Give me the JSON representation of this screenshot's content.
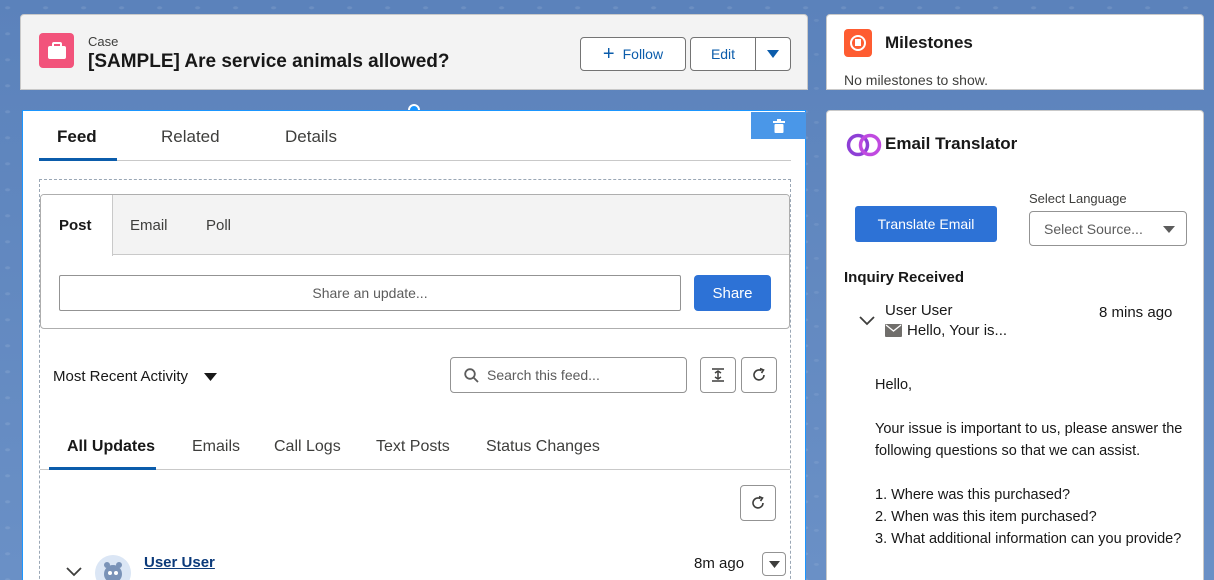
{
  "record": {
    "object_label": "Case",
    "title": "[SAMPLE] Are service animals allowed?",
    "follow_label": "Follow",
    "edit_label": "Edit"
  },
  "feed_tabs": [
    "Feed",
    "Related",
    "Details"
  ],
  "publisher": {
    "tabs": [
      "Post",
      "Email",
      "Poll"
    ],
    "input_placeholder": "Share an update...",
    "share_label": "Share"
  },
  "feed": {
    "sort_label": "Most Recent Activity",
    "search_placeholder": "Search this feed...",
    "filter_tabs": [
      "All Updates",
      "Emails",
      "Call Logs",
      "Text Posts",
      "Status Changes"
    ],
    "items": [
      {
        "user": "User User",
        "time": "8m ago"
      }
    ]
  },
  "milestones": {
    "title": "Milestones",
    "empty_text": "No milestones to show."
  },
  "email_translator": {
    "title": "Email Translator",
    "translate_label": "Translate Email",
    "language_label": "Select Language",
    "language_value": "Select Source...",
    "section_title": "Inquiry Received",
    "email": {
      "from": "User User",
      "time": "8 mins ago",
      "snippet": "Hello, Your is...",
      "body": [
        "Hello,",
        "Your issue is important to us, please answer the following questions so that we can assist.",
        "1. Where was this purchased?\n2. When was this item purchased?\n3. What additional information can you provide?"
      ]
    }
  },
  "colors": {
    "brand_blue": "#0b5cab",
    "button_blue": "#2d72d6",
    "case_icon": "#f2537b",
    "milestone_icon": "#fe5c31",
    "background": "#5f86be"
  }
}
